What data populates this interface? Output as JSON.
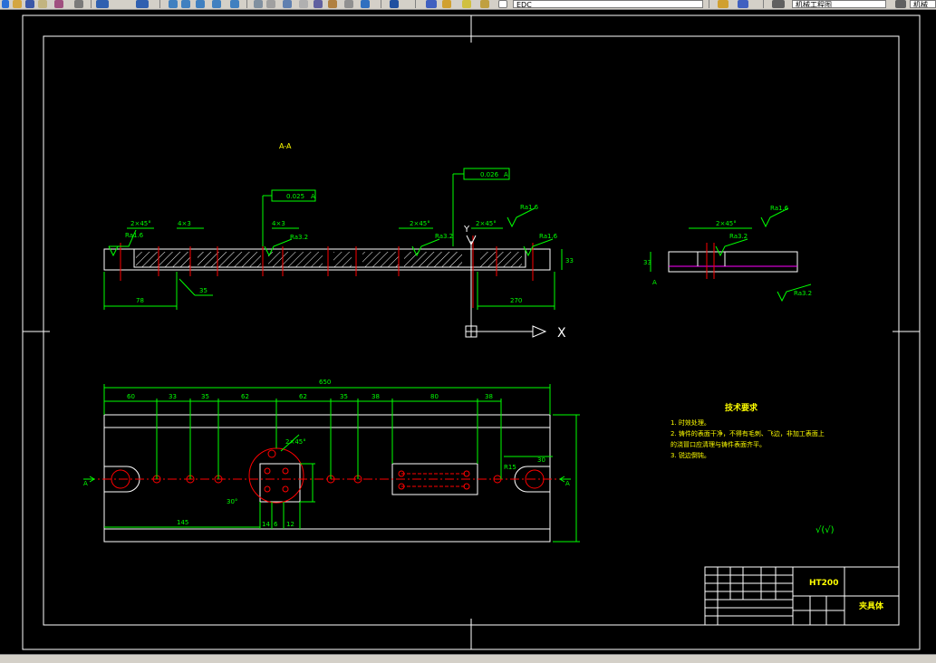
{
  "toolbar": {
    "layer_value": "EDC",
    "style_value": "机械工程图",
    "extra_value": "机械"
  },
  "drawing": {
    "section_label": "A-A",
    "tolerance_top": "0.026",
    "tolerance_mid": "0.025",
    "datum": "A",
    "roughness_1": "Ra1.6",
    "roughness_2": "Ra3.2",
    "chamfer_1": "2×45°",
    "chamfer_2": "4×3",
    "chamfer_3": "4×3",
    "dim_height": "33",
    "dim_left": "78",
    "dim_right": "270",
    "dim_35": "35",
    "dim_total": "650",
    "dims_top": [
      "60",
      "33",
      "35",
      "62",
      "62",
      "35",
      "38",
      "80",
      "38"
    ],
    "dim_bottom_145": "145",
    "dim_bottom_small": [
      "14",
      "6",
      "12"
    ],
    "dim_angle": "30°",
    "dim_r": "R15",
    "dim_side": "30",
    "axis_x_label": "X",
    "axis_y_label": "Y",
    "cut_label_left": "A",
    "cut_label_right": "A",
    "tech_title": "技术要求",
    "tech_lines": [
      "1. 时效处理。",
      "2. 铸件的表面干净，不得有毛刺、飞边，非加工表面上",
      "的浇冒口应清理与铸件表面齐平。",
      "3. 锐边倒钝。"
    ],
    "material": "HT200",
    "part_name": "夹具体",
    "roughness_symbol": "√(√)"
  },
  "colors": {
    "frame": "#ffffff",
    "outline": "#ffffff",
    "dimension": "#00ff00",
    "centerline": "#ff0000",
    "hatch": "#ffffff",
    "annotation": "#ffff00",
    "highlight": "#ff00ff"
  }
}
